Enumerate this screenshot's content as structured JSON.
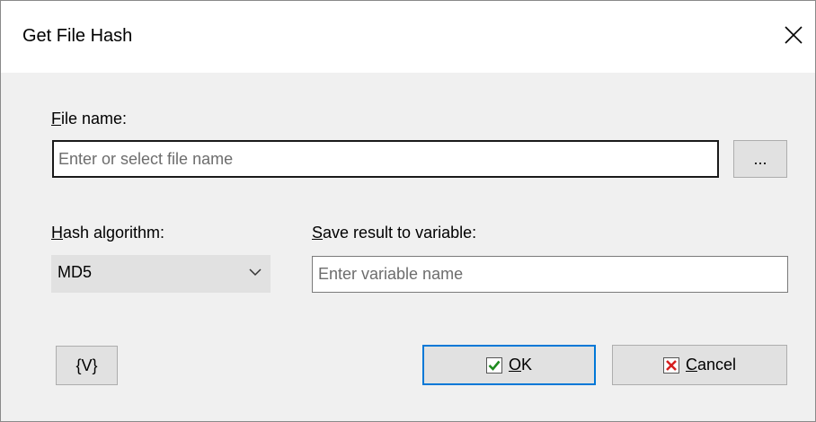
{
  "window": {
    "title": "Get File Hash"
  },
  "file_name": {
    "label_accel": "F",
    "label_rest": "ile name:",
    "placeholder": "Enter or select file name",
    "browse_label": "..."
  },
  "hash_algorithm": {
    "label_accel": "H",
    "label_rest": "ash algorithm:",
    "selected": "MD5"
  },
  "save_result": {
    "label_accel": "S",
    "label_rest": "ave result to variable:",
    "placeholder": "Enter variable name"
  },
  "buttons": {
    "variables_label": "{V}",
    "ok_accel": "O",
    "ok_rest": "K",
    "cancel_accel": "C",
    "cancel_rest": "ancel"
  },
  "colors": {
    "ok_check": "#1e8b1e",
    "cancel_x": "#d62020",
    "default_button_border": "#0078d7"
  },
  "icons": {
    "close": "close-icon",
    "dropdown": "chevron-down-icon",
    "ok": "checkmark-icon",
    "cancel": "x-mark-icon"
  }
}
